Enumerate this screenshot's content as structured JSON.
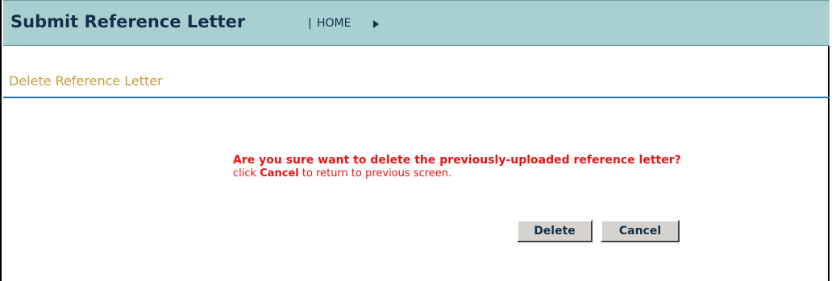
{
  "header": {
    "title": "Submit Reference Letter",
    "separator": "|",
    "home_link": "HOME",
    "background_color": "#a9d0d0",
    "text_color": "#12304a"
  },
  "section": {
    "title": "Delete Reference Letter",
    "title_color": "#c99d3a",
    "rule_color": "#1e6fa8"
  },
  "message": {
    "question": "Are you sure want to delete the previously-uploaded reference letter?",
    "hint_prefix": "click ",
    "hint_keyword": "Cancel",
    "hint_suffix": " to return to previous screen.",
    "color": "#ee1111"
  },
  "buttons": {
    "delete_label": "Delete",
    "cancel_label": "Cancel"
  },
  "icons": {
    "home_arrow": "triangle-right-icon"
  }
}
